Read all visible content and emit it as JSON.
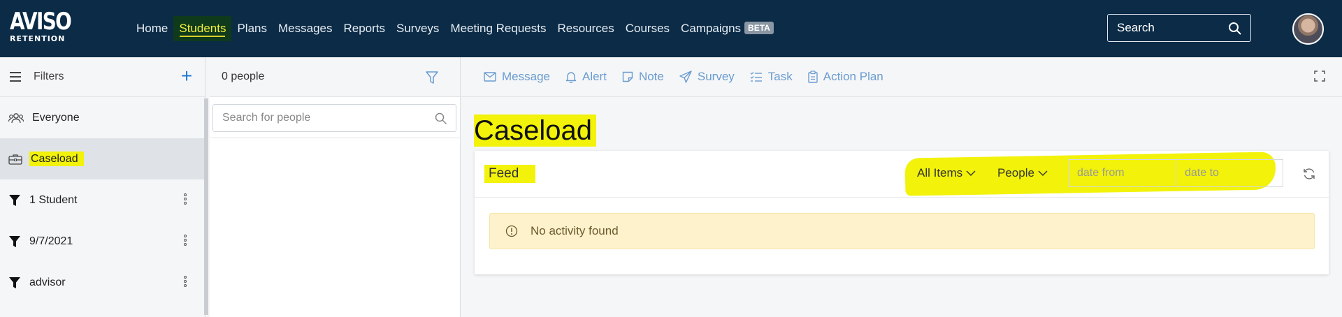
{
  "logo": {
    "line1": "AVISO",
    "line2": "RETENTION"
  },
  "nav": [
    {
      "label": "Home"
    },
    {
      "label": "Students"
    },
    {
      "label": "Plans"
    },
    {
      "label": "Messages"
    },
    {
      "label": "Reports"
    },
    {
      "label": "Surveys"
    },
    {
      "label": "Meeting Requests"
    },
    {
      "label": "Resources"
    },
    {
      "label": "Courses"
    },
    {
      "label": "Campaigns",
      "badge": "BETA"
    }
  ],
  "top_search": {
    "placeholder": "Search"
  },
  "filters": {
    "title": "Filters",
    "items": [
      {
        "label": "Everyone",
        "icon": "users-icon"
      },
      {
        "label": "Caseload",
        "icon": "briefcase-icon"
      },
      {
        "label": "1 Student",
        "icon": "filter-icon"
      },
      {
        "label": "9/7/2021",
        "icon": "filter-icon"
      },
      {
        "label": "advisor",
        "icon": "filter-icon"
      }
    ]
  },
  "people": {
    "count_label": "0 people",
    "search_placeholder": "Search for people"
  },
  "toolbar": {
    "actions": [
      {
        "label": "Message",
        "icon": "envelope-icon"
      },
      {
        "label": "Alert",
        "icon": "bell-icon"
      },
      {
        "label": "Note",
        "icon": "note-icon"
      },
      {
        "label": "Survey",
        "icon": "paper-plane-icon"
      },
      {
        "label": "Task",
        "icon": "task-list-icon"
      },
      {
        "label": "Action Plan",
        "icon": "clipboard-icon"
      }
    ]
  },
  "main": {
    "title": "Caseload",
    "feed": {
      "title": "Feed",
      "all_items_label": "All Items",
      "people_label": "People",
      "date_from_placeholder": "date from",
      "date_to_placeholder": "date to",
      "empty_message": "No activity found"
    }
  },
  "colors": {
    "topbar": "#0b2b47",
    "accent": "#1f7ad1",
    "toolbar_text": "#6a9ccf",
    "highlight": "#f2f20a",
    "alert_bg": "#fdf2cc"
  }
}
